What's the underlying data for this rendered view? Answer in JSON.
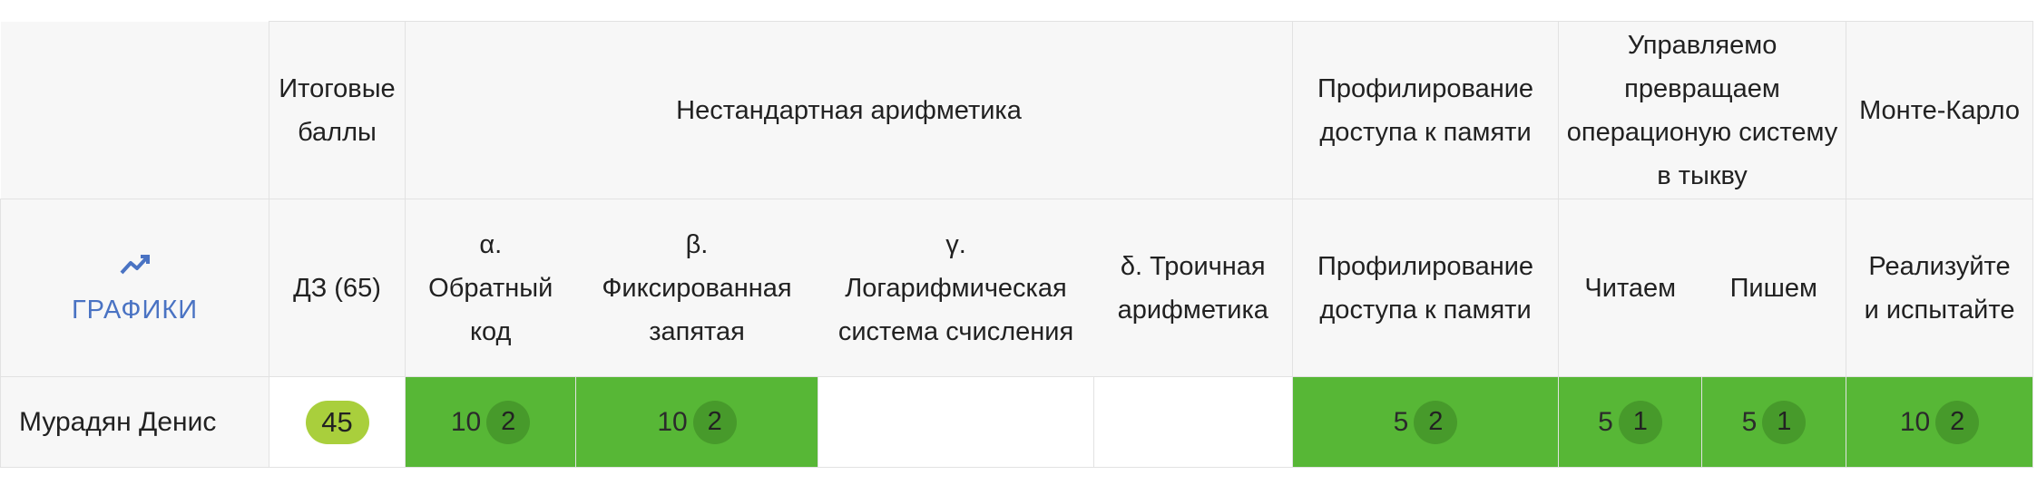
{
  "columns": {
    "totals_group": "Итоговые баллы",
    "arith_group": "Нестандартная арифметика",
    "profiling_group": "Профилирование доступа к памяти",
    "pumpkin_group": "Управляемо превращаем операционую систему в тыкву",
    "montecarlo_group": "Монте-Карло",
    "charts_link": "ГРАФИКИ",
    "hw_total": "ДЗ (65)",
    "alpha": "α. Обратный код",
    "beta": "β. Фиксированная запятая",
    "gamma": "γ. Логарифмическая система счисления",
    "delta": "δ. Троичная арифметика",
    "profiling": "Профилирование доступа к памяти",
    "read": "Читаем",
    "write": "Пишем",
    "implement": "Реализуйте и испытайте"
  },
  "rows": [
    {
      "name": "Мурадян Денис",
      "total": "45",
      "alpha": {
        "points": "10",
        "attempts": "2"
      },
      "beta": {
        "points": "10",
        "attempts": "2"
      },
      "profiling": {
        "points": "5",
        "attempts": "2"
      },
      "read": {
        "points": "5",
        "attempts": "1"
      },
      "write": {
        "points": "5",
        "attempts": "1"
      },
      "implement": {
        "points": "10",
        "attempts": "2"
      }
    }
  ],
  "colors": {
    "passed": "#57b736",
    "attempt_badge": "#479a2b",
    "total_badge": "#a9cf3c",
    "link": "#4a73c3",
    "header_bg": "#f7f7f7"
  },
  "icons": {
    "charts": "trending-up-icon"
  }
}
